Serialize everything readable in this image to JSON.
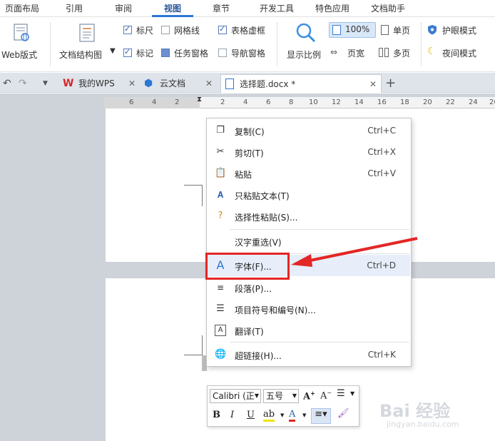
{
  "ribbon_tabs": [
    "页面布局",
    "引用",
    "审阅",
    "视图",
    "章节",
    "开发工具",
    "特色应用",
    "文档助手"
  ],
  "ribbon": {
    "web_layout": "Web版式",
    "doc_structure": "文档结构图",
    "ruler": "标尺",
    "gridlines": "网格线",
    "table_gridlines": "表格虚框",
    "marks": "标记",
    "task_pane": "任务窗格",
    "nav_pane": "导航窗格",
    "zoom": "显示比例",
    "zoom_100": "100%",
    "one_page": "单页",
    "page_width": "页宽",
    "multi_page": "多页",
    "eye_mode": "护眼模式",
    "night_mode": "夜间模式"
  },
  "doc_tabs": {
    "wps": "我的WPS",
    "cloud": "云文档",
    "doc": "选择题.docx *",
    "add": "+"
  },
  "ruler_numbers": [
    "6",
    "4",
    "2",
    "2",
    "4",
    "6",
    "8",
    "10",
    "12",
    "14",
    "16",
    "18",
    "20",
    "22",
    "24",
    "26"
  ],
  "context_menu": {
    "items": [
      {
        "label": "复制(C)",
        "shortcut": "Ctrl+C",
        "icon": "copy-icon"
      },
      {
        "label": "剪切(T)",
        "shortcut": "Ctrl+X",
        "icon": "scissors-icon"
      },
      {
        "label": "粘贴",
        "shortcut": "Ctrl+V",
        "icon": "paste-icon"
      },
      {
        "label": "只粘贴文本(T)",
        "shortcut": "",
        "icon": "paste-text-icon"
      },
      {
        "label": "选择性粘贴(S)...",
        "shortcut": "",
        "icon": "paste-special-icon"
      },
      {
        "label": "汉字重选(V)",
        "shortcut": "",
        "icon": ""
      },
      {
        "label": "字体(F)...",
        "shortcut": "Ctrl+D",
        "icon": "font-icon"
      },
      {
        "label": "段落(P)...",
        "shortcut": "",
        "icon": "paragraph-icon"
      },
      {
        "label": "项目符号和编号(N)...",
        "shortcut": "",
        "icon": "bullet-list-icon"
      },
      {
        "label": "翻译(T)",
        "shortcut": "",
        "icon": "translate-icon"
      },
      {
        "label": "超链接(H)...",
        "shortcut": "Ctrl+K",
        "icon": "hyperlink-icon"
      }
    ]
  },
  "mini_toolbar": {
    "font_name": "Calibri (正",
    "font_size": "五号",
    "bold": "B",
    "italic": "I",
    "underline": "U"
  },
  "watermark": {
    "brand": "Bai 经验",
    "url": "jingyan.baidu.com"
  },
  "colors": {
    "accent": "#2b77d6",
    "highlight": "#e7eef9",
    "annotation": "#e32626"
  }
}
